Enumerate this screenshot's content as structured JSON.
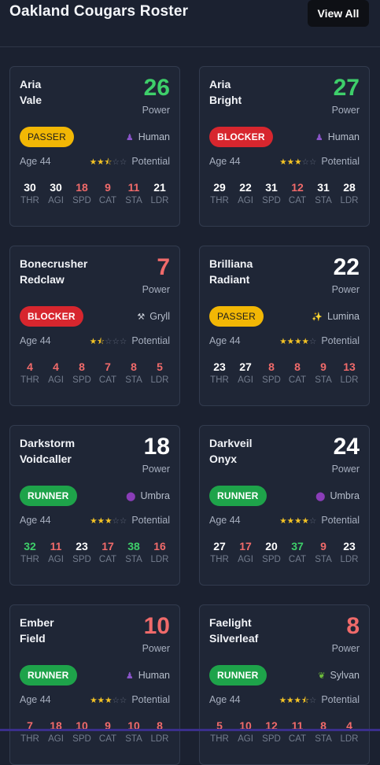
{
  "header": {
    "title": "Oakland Cougars Roster",
    "view_all_label": "View All"
  },
  "labels": {
    "power": "Power",
    "potential": "Potential"
  },
  "stat_keys": [
    "THR",
    "AGI",
    "SPD",
    "CAT",
    "STA",
    "LDR"
  ],
  "colors": {
    "high": "#3ecf6a",
    "low": "#f06a6a",
    "neutral": "#ffffff",
    "passer_bg": "#f2b705",
    "passer_fg": "#1d1d1d",
    "blocker_bg": "#d7262e",
    "blocker_fg": "#ffffff",
    "runner_bg": "#1ea34a",
    "runner_fg": "#ffffff",
    "star_on": "#f5c425",
    "star_off": "#5d6577"
  },
  "players": [
    {
      "first": "Aria",
      "last": "Vale",
      "power": "26",
      "power_tone": "high",
      "role": "PASSER",
      "race": "Human",
      "race_icon": "human-icon",
      "race_glyph": "♟",
      "race_color": "#8a55c9",
      "age": "Age 44",
      "stars": 2.5,
      "stats": [
        {
          "v": "30",
          "t": "neutral"
        },
        {
          "v": "30",
          "t": "neutral"
        },
        {
          "v": "18",
          "t": "low"
        },
        {
          "v": "9",
          "t": "low"
        },
        {
          "v": "11",
          "t": "low"
        },
        {
          "v": "21",
          "t": "neutral"
        }
      ]
    },
    {
      "first": "Aria",
      "last": "Bright",
      "power": "27",
      "power_tone": "high",
      "role": "BLOCKER",
      "race": "Human",
      "race_icon": "human-icon",
      "race_glyph": "♟",
      "race_color": "#8a55c9",
      "age": "Age 44",
      "stars": 3,
      "stats": [
        {
          "v": "29",
          "t": "neutral"
        },
        {
          "v": "22",
          "t": "neutral"
        },
        {
          "v": "31",
          "t": "neutral"
        },
        {
          "v": "12",
          "t": "low"
        },
        {
          "v": "31",
          "t": "neutral"
        },
        {
          "v": "28",
          "t": "neutral"
        }
      ]
    },
    {
      "first": "Bonecrusher",
      "last": "Redclaw",
      "power": "7",
      "power_tone": "low",
      "role": "BLOCKER",
      "race": "Gryll",
      "race_icon": "hammer-pick-icon",
      "race_glyph": "⚒",
      "race_color": "#c9ced8",
      "age": "Age 44",
      "stars": 1.5,
      "stats": [
        {
          "v": "4",
          "t": "low"
        },
        {
          "v": "4",
          "t": "low"
        },
        {
          "v": "8",
          "t": "low"
        },
        {
          "v": "7",
          "t": "low"
        },
        {
          "v": "8",
          "t": "low"
        },
        {
          "v": "5",
          "t": "low"
        }
      ]
    },
    {
      "first": "Brilliana",
      "last": "Radiant",
      "power": "22",
      "power_tone": "neutral",
      "role": "PASSER",
      "race": "Lumina",
      "race_icon": "sparkles-icon",
      "race_glyph": "✨",
      "race_color": "#f5c425",
      "age": "Age 44",
      "stars": 4,
      "stats": [
        {
          "v": "23",
          "t": "neutral"
        },
        {
          "v": "27",
          "t": "neutral"
        },
        {
          "v": "8",
          "t": "low"
        },
        {
          "v": "8",
          "t": "low"
        },
        {
          "v": "9",
          "t": "low"
        },
        {
          "v": "13",
          "t": "low"
        }
      ]
    },
    {
      "first": "Darkstorm",
      "last": "Voidcaller",
      "power": "18",
      "power_tone": "neutral",
      "role": "RUNNER",
      "race": "Umbra",
      "race_icon": "umbra-orb-icon",
      "race_glyph": "⬤",
      "race_color": "#8a3db8",
      "age": "Age 44",
      "stars": 3,
      "stats": [
        {
          "v": "32",
          "t": "high"
        },
        {
          "v": "11",
          "t": "low"
        },
        {
          "v": "23",
          "t": "neutral"
        },
        {
          "v": "17",
          "t": "low"
        },
        {
          "v": "38",
          "t": "high"
        },
        {
          "v": "16",
          "t": "low"
        }
      ]
    },
    {
      "first": "Darkveil",
      "last": "Onyx",
      "power": "24",
      "power_tone": "neutral",
      "role": "RUNNER",
      "race": "Umbra",
      "race_icon": "umbra-orb-icon",
      "race_glyph": "⬤",
      "race_color": "#8a3db8",
      "age": "Age 44",
      "stars": 4,
      "stats": [
        {
          "v": "27",
          "t": "neutral"
        },
        {
          "v": "17",
          "t": "low"
        },
        {
          "v": "20",
          "t": "neutral"
        },
        {
          "v": "37",
          "t": "high"
        },
        {
          "v": "9",
          "t": "low"
        },
        {
          "v": "23",
          "t": "neutral"
        }
      ]
    },
    {
      "first": "Ember",
      "last": "Field",
      "power": "10",
      "power_tone": "low",
      "role": "RUNNER",
      "race": "Human",
      "race_icon": "human-icon",
      "race_glyph": "♟",
      "race_color": "#8a55c9",
      "age": "Age 44",
      "stars": 3,
      "stats": [
        {
          "v": "7",
          "t": "low"
        },
        {
          "v": "18",
          "t": "low"
        },
        {
          "v": "10",
          "t": "low"
        },
        {
          "v": "9",
          "t": "low"
        },
        {
          "v": "10",
          "t": "low"
        },
        {
          "v": "8",
          "t": "low"
        }
      ]
    },
    {
      "first": "Faelight",
      "last": "Silverleaf",
      "power": "8",
      "power_tone": "low",
      "role": "RUNNER",
      "race": "Sylvan",
      "race_icon": "leaf-icon",
      "race_glyph": "❦",
      "race_color": "#6fbf3c",
      "age": "Age 44",
      "stars": 3.5,
      "stats": [
        {
          "v": "5",
          "t": "low"
        },
        {
          "v": "10",
          "t": "low"
        },
        {
          "v": "12",
          "t": "low"
        },
        {
          "v": "11",
          "t": "low"
        },
        {
          "v": "8",
          "t": "low"
        },
        {
          "v": "4",
          "t": "low"
        }
      ]
    }
  ]
}
